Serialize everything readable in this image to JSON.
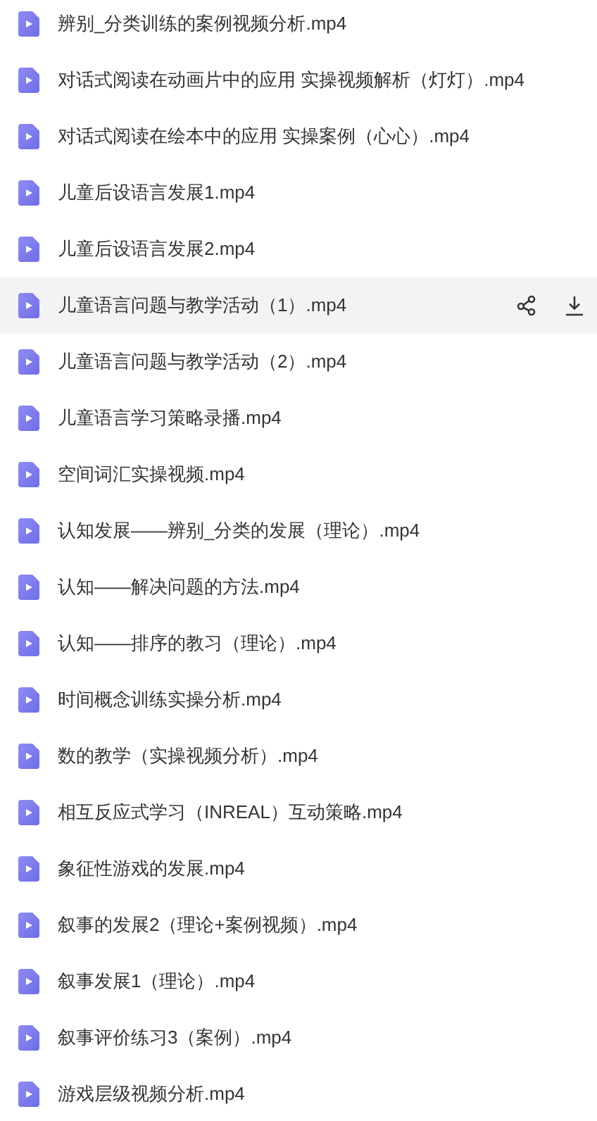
{
  "files": [
    {
      "name": "辨别_分类训练的案例视频分析.mp4",
      "highlighted": false
    },
    {
      "name": "对话式阅读在动画片中的应用  实操视频解析（灯灯）.mp4",
      "highlighted": false
    },
    {
      "name": "对话式阅读在绘本中的应用 实操案例（心心）.mp4",
      "highlighted": false
    },
    {
      "name": "儿童后设语言发展1.mp4",
      "highlighted": false
    },
    {
      "name": "儿童后设语言发展2.mp4",
      "highlighted": false
    },
    {
      "name": "儿童语言问题与教学活动（1）.mp4",
      "highlighted": true
    },
    {
      "name": "儿童语言问题与教学活动（2）.mp4",
      "highlighted": false
    },
    {
      "name": "儿童语言学习策略录播.mp4",
      "highlighted": false
    },
    {
      "name": "空间词汇实操视频.mp4",
      "highlighted": false
    },
    {
      "name": "认知发展——辨别_分类的发展（理论）.mp4",
      "highlighted": false
    },
    {
      "name": "认知——解决问题的方法.mp4",
      "highlighted": false
    },
    {
      "name": "认知——排序的教习（理论）.mp4",
      "highlighted": false
    },
    {
      "name": "时间概念训练实操分析.mp4",
      "highlighted": false
    },
    {
      "name": "数的教学（实操视频分析）.mp4",
      "highlighted": false
    },
    {
      "name": "相互反应式学习（INREAL）互动策略.mp4",
      "highlighted": false
    },
    {
      "name": "象征性游戏的发展.mp4",
      "highlighted": false
    },
    {
      "name": "叙事的发展2（理论+案例视频）.mp4",
      "highlighted": false
    },
    {
      "name": "叙事发展1（理论）.mp4",
      "highlighted": false
    },
    {
      "name": "叙事评价练习3（案例）.mp4",
      "highlighted": false
    },
    {
      "name": "游戏层级视频分析.mp4",
      "highlighted": false
    }
  ]
}
